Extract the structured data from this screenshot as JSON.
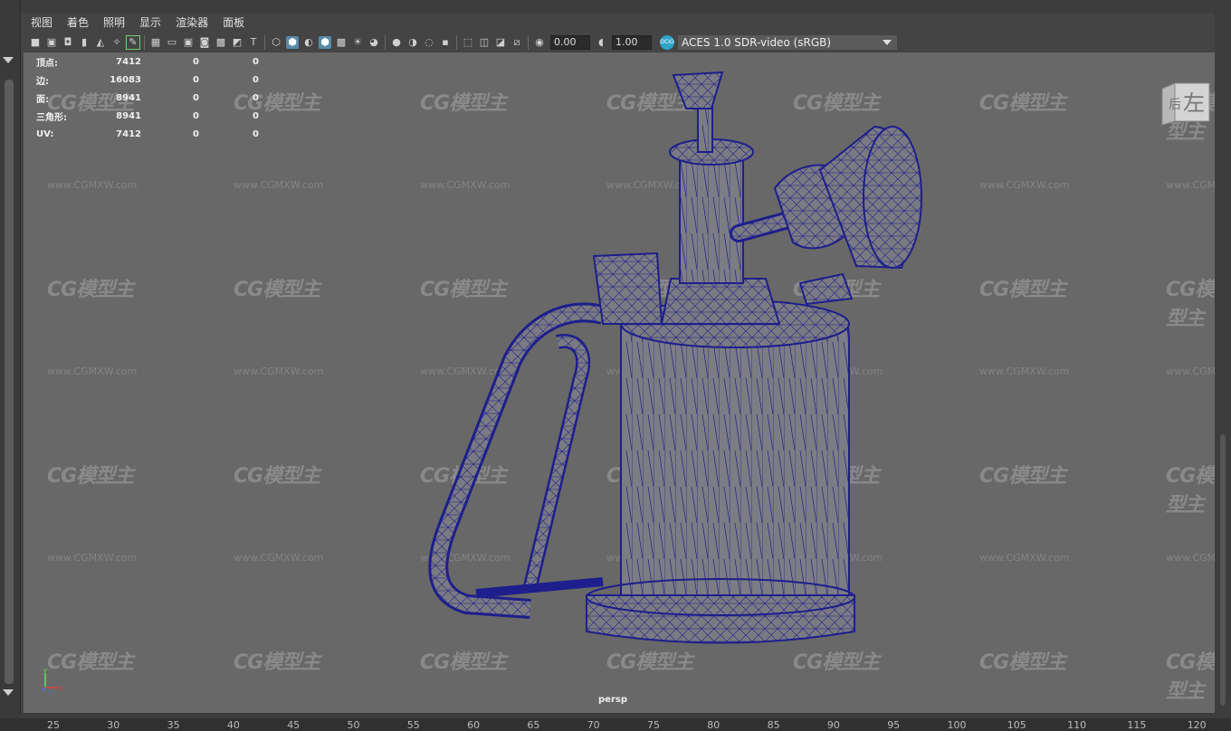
{
  "menu": [
    "视图",
    "着色",
    "照明",
    "显示",
    "渲染器",
    "面板"
  ],
  "toolbar": {
    "exposure_value": "0.00",
    "gamma_value": "1.00",
    "cs_icon_label": "OCIO",
    "color_space": "ACES 1.0 SDR-video (sRGB)"
  },
  "hud": {
    "rows": [
      {
        "label": "顶点:",
        "value": "7412",
        "sel": "0",
        "uv": "0"
      },
      {
        "label": "边:",
        "value": "16083",
        "sel": "0",
        "uv": "0"
      },
      {
        "label": "面:",
        "value": "8941",
        "sel": "0",
        "uv": "0"
      },
      {
        "label": "三角形:",
        "value": "8941",
        "sel": "0",
        "uv": "0"
      },
      {
        "label": "UV:",
        "value": "7412",
        "sel": "0",
        "uv": "0"
      }
    ]
  },
  "viewport": {
    "camera": "persp",
    "viewcube_left": "左",
    "viewcube_back": "后",
    "wire_color": "#1e1e8c",
    "bg_color": "#686868"
  },
  "watermark": {
    "brand": "CG模型主",
    "url": "www.CGMXW.com"
  },
  "ruler": [
    "25",
    "30",
    "35",
    "40",
    "45",
    "50",
    "55",
    "60",
    "65",
    "70",
    "75",
    "80",
    "85",
    "90",
    "95",
    "100",
    "105",
    "110",
    "115",
    "120"
  ],
  "axis": {
    "x": "x",
    "y": "y",
    "z": "z"
  }
}
